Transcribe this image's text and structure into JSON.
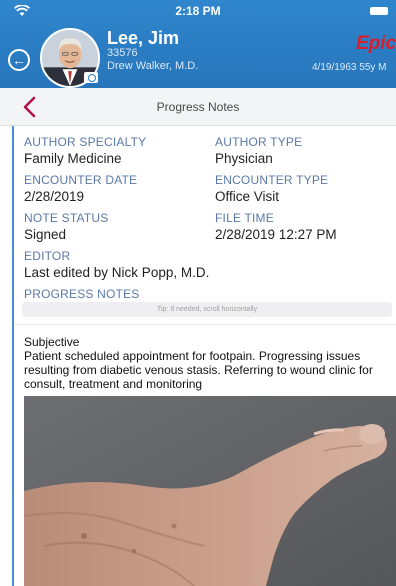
{
  "status_bar": {
    "time": "2:18 PM"
  },
  "patient": {
    "name": "Lee, Jim",
    "mrn": "33576",
    "provider": "Drew Walker, M.D.",
    "dob_age": "4/19/1963 55y M"
  },
  "brand": {
    "logo_text": "Epic"
  },
  "page": {
    "title": "Progress Notes"
  },
  "fields": {
    "author_specialty": {
      "label": "AUTHOR SPECIALTY",
      "value": "Family Medicine"
    },
    "author_type": {
      "label": "AUTHOR TYPE",
      "value": "Physician"
    },
    "encounter_date": {
      "label": "ENCOUNTER DATE",
      "value": "2/28/2019"
    },
    "encounter_type": {
      "label": "ENCOUNTER TYPE",
      "value": "Office Visit"
    },
    "note_status": {
      "label": "NOTE STATUS",
      "value": "Signed"
    },
    "file_time": {
      "label": "FILE TIME",
      "value": "2/28/2019 12:27 PM"
    },
    "editor": {
      "label": "EDITOR",
      "value": "Last edited by Nick Popp, M.D."
    },
    "progress_notes": {
      "label": "PROGRESS NOTES"
    }
  },
  "tip": "Tip: If needed, scroll horizontally",
  "note": {
    "heading": "Subjective",
    "body": "Patient scheduled appointment for footpain. Progressing issues resulting from diabetic venous stasis. Referring to wound clinic for consult, treatment and monitoring"
  },
  "colors": {
    "header_blue": "#2a7cc2",
    "label_blue": "#5a79a7",
    "accent_red": "#d61f2e",
    "back_chevron": "#b0124d"
  },
  "icons": {
    "wifi": "wifi-icon",
    "battery": "battery-icon",
    "back_circle": "back-circle-icon",
    "camera": "camera-icon",
    "back_chevron": "chevron-left-icon"
  }
}
